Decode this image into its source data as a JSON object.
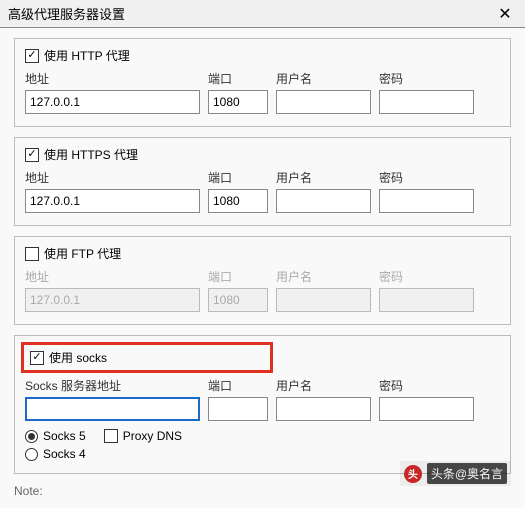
{
  "title": "高级代理服务器设置",
  "labels": {
    "address": "地址",
    "port": "端口",
    "username": "用户名",
    "password": "密码"
  },
  "http": {
    "enable_label": "使用 HTTP 代理",
    "checked": true,
    "address": "127.0.0.1",
    "port": "1080",
    "user": "",
    "pass": ""
  },
  "https": {
    "enable_label": "使用 HTTPS 代理",
    "checked": true,
    "address": "127.0.0.1",
    "port": "1080",
    "user": "",
    "pass": ""
  },
  "ftp": {
    "enable_label": "使用 FTP 代理",
    "checked": false,
    "address": "127.0.0.1",
    "port": "1080",
    "user": "",
    "pass": ""
  },
  "socks": {
    "enable_label": "使用 socks",
    "checked": true,
    "addr_label": "Socks 服务器地址",
    "address": "",
    "port": "",
    "user": "",
    "pass": "",
    "socks5_label": "Socks 5",
    "socks4_label": "Socks 4",
    "proxy_dns_label": "Proxy DNS",
    "version": "5",
    "proxy_dns": false
  },
  "note": "Note:",
  "watermark": "头条@奥名言"
}
